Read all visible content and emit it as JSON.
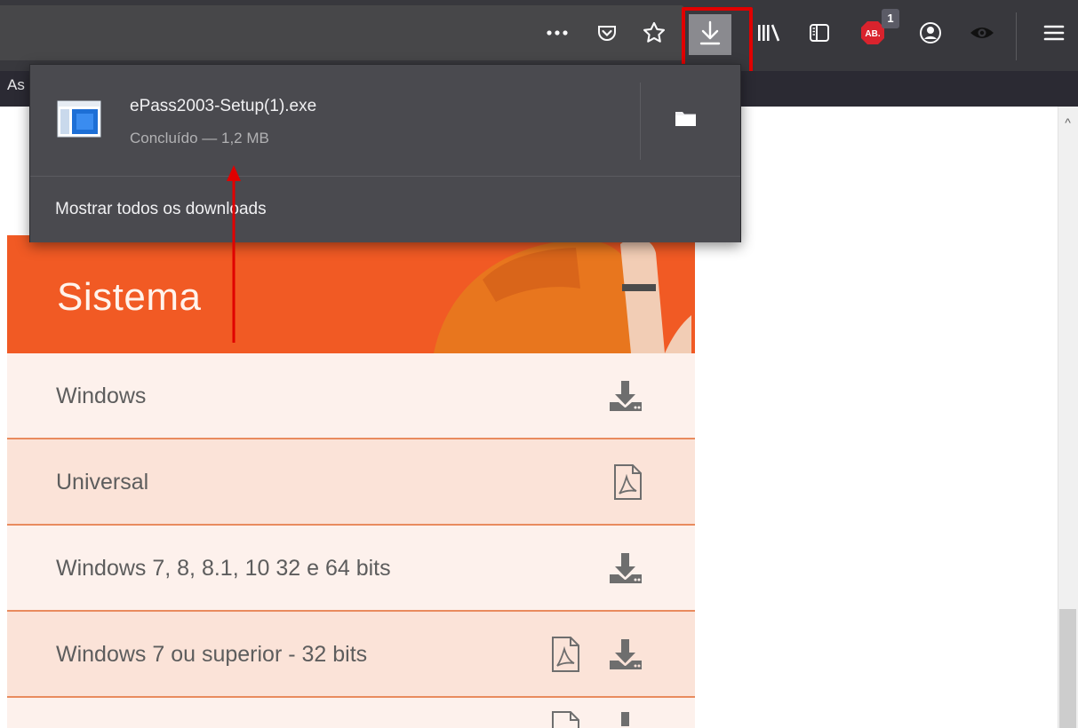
{
  "toolbar": {
    "icons": [
      "more-icon",
      "pocket-icon",
      "bookmark-star-icon",
      "downloads-icon",
      "library-icon",
      "sidebar-icon",
      "adblock-icon",
      "account-icon",
      "extension-eye-icon",
      "menu-icon"
    ],
    "adblock_badge": "1",
    "bookmarks_partial": "As"
  },
  "download_panel": {
    "file_name": "ePass2003-Setup(1).exe",
    "status": "Concluído — 1,2 MB",
    "show_all_label": "Mostrar todos os downloads"
  },
  "page": {
    "hero_title": "Sistema",
    "rows": [
      {
        "label": "Windows",
        "icons": [
          "download-icon"
        ]
      },
      {
        "label": "Universal",
        "icons": [
          "pdf-icon"
        ]
      },
      {
        "label": "Windows 7, 8, 8.1, 10 32 e 64 bits",
        "icons": [
          "download-icon"
        ]
      },
      {
        "label": "Windows 7 ou superior - 32 bits",
        "icons": [
          "pdf-icon",
          "download-icon"
        ]
      },
      {
        "label": "",
        "icons": [
          "pdf-icon",
          "download-icon"
        ]
      }
    ]
  },
  "colors": {
    "toolbar": "#38383d",
    "panel": "#4a4a4f",
    "accent_orange": "#f15a24",
    "highlight_red": "#e10000",
    "row_light": "#fdf1ec",
    "row_dark": "#fbe3d8"
  }
}
